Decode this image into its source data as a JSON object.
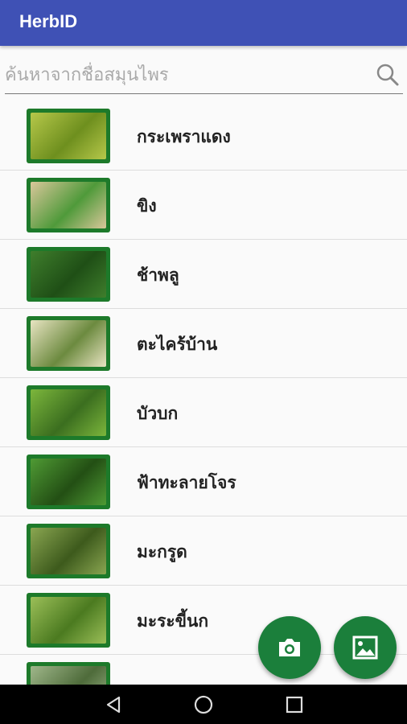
{
  "app": {
    "title": "HerbID"
  },
  "search": {
    "placeholder": "ค้นหาจากชื่อสมุนไพร"
  },
  "herbs": [
    {
      "name": "กระเพราแดง",
      "thumb_colors": [
        "#b6c84a",
        "#6e8f1e"
      ]
    },
    {
      "name": "ขิง",
      "thumb_colors": [
        "#d9c79a",
        "#4f9a3a"
      ]
    },
    {
      "name": "ช้าพลู",
      "thumb_colors": [
        "#3f7e2c",
        "#1f4f16"
      ]
    },
    {
      "name": "ตะไคร้บ้าน",
      "thumb_colors": [
        "#e8e4c2",
        "#6c8a3f"
      ]
    },
    {
      "name": "บัวบก",
      "thumb_colors": [
        "#7cb63c",
        "#3b6e1f"
      ]
    },
    {
      "name": "ฟ้าทะลายโจร",
      "thumb_colors": [
        "#4f9a34",
        "#234f14"
      ]
    },
    {
      "name": "มะกรูด",
      "thumb_colors": [
        "#8aa651",
        "#3d5a1c"
      ]
    },
    {
      "name": "มะระขี้นก",
      "thumb_colors": [
        "#9bbf58",
        "#4b7a20"
      ]
    },
    {
      "name": "",
      "thumb_colors": [
        "#9fb78a",
        "#4e6b3a"
      ]
    }
  ],
  "colors": {
    "primary": "#3f51b5",
    "fab": "#1b7f3b",
    "thumb_frame": "#1d7a2a"
  },
  "icons": {
    "search": "search-icon",
    "camera": "camera-icon",
    "gallery": "image-icon"
  }
}
